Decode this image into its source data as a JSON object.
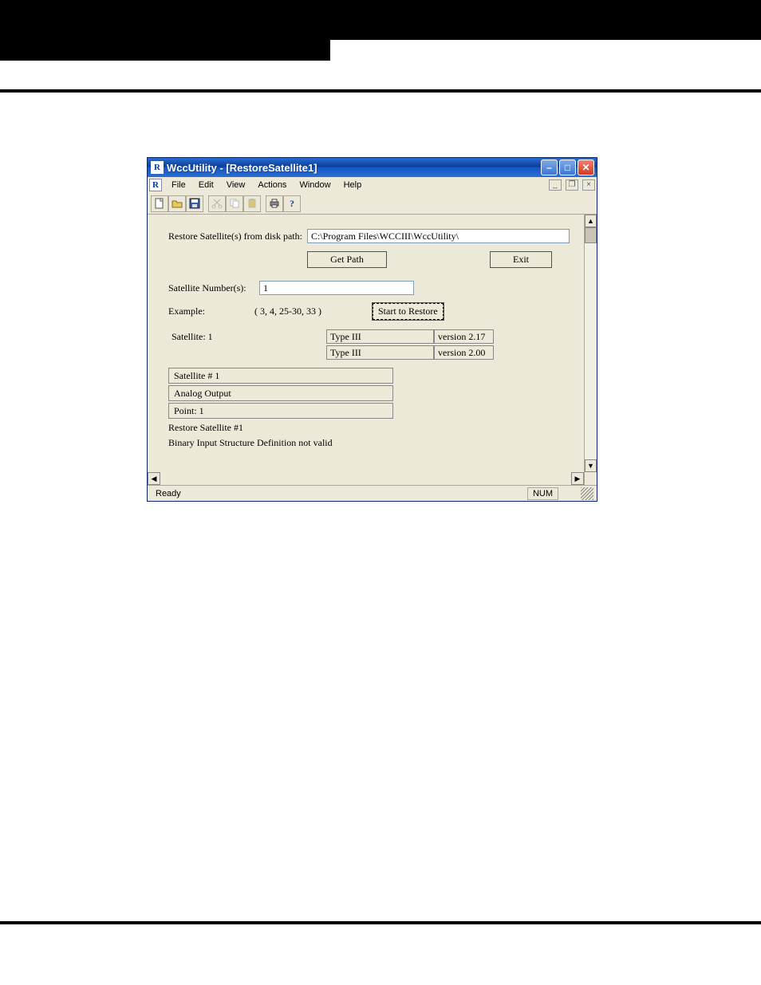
{
  "window": {
    "title": "WccUtility - [RestoreSatellite1]"
  },
  "menu": {
    "file": "File",
    "edit": "Edit",
    "view": "View",
    "actions": "Actions",
    "window": "Window",
    "help": "Help"
  },
  "form": {
    "restore_label": "Restore Satellite(s) from disk path:",
    "path_value": "C:\\Program Files\\WCCIII\\WccUtility\\",
    "get_path_label": "Get Path",
    "exit_label": "Exit",
    "satnum_label": "Satellite Number(s):",
    "satnum_value": "1",
    "example_label": "Example:",
    "example_value": "( 3, 4, 25-30, 33 )",
    "start_label": "Start to Restore"
  },
  "grid": {
    "r1": {
      "sat": "Satellite: 1",
      "type": "Type III",
      "ver": "version 2.17"
    },
    "r2": {
      "sat": "",
      "type": "Type III",
      "ver": "version 2.00"
    }
  },
  "log": {
    "line1": "Satellite # 1",
    "line2": "Analog Output",
    "line3": "Point: 1",
    "line4": "Restore Satellite #1",
    "line5": "Binary Input Structure Definition not valid"
  },
  "status": {
    "ready": "Ready",
    "num": "NUM"
  }
}
